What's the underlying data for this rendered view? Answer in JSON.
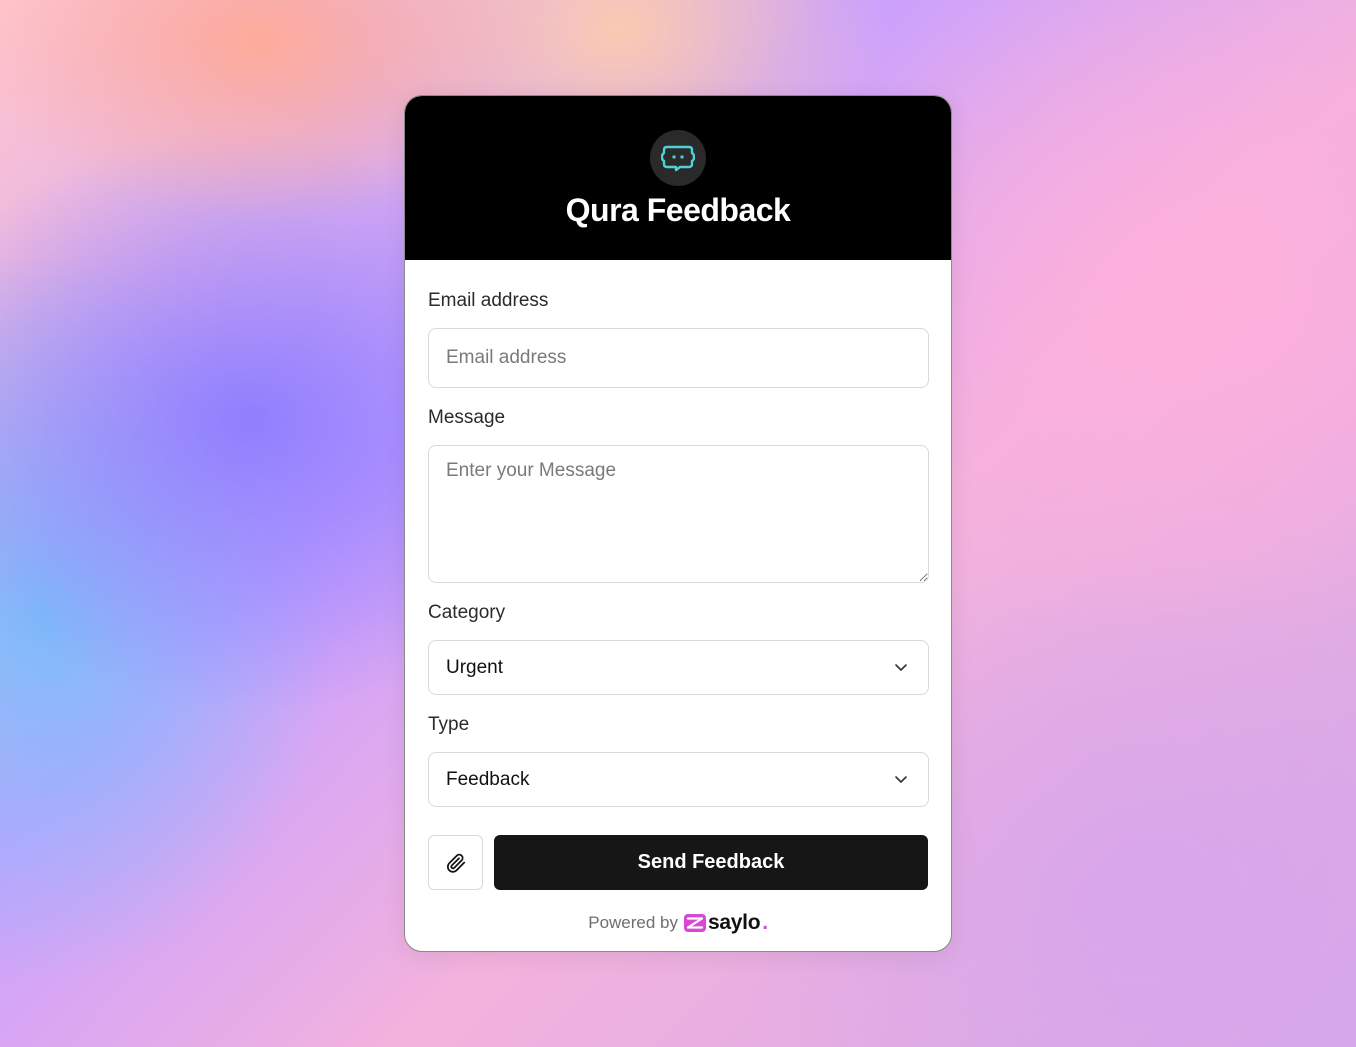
{
  "app": {
    "title": "Qura Feedback",
    "logo_icon": "chat-bubble-icon",
    "accent_color": "#4fd1d9"
  },
  "form": {
    "email": {
      "label": "Email address",
      "placeholder": "Email address",
      "value": ""
    },
    "message": {
      "label": "Message",
      "placeholder": "Enter your Message",
      "value": ""
    },
    "category": {
      "label": "Category",
      "selected": "Urgent"
    },
    "type": {
      "label": "Type",
      "selected": "Feedback"
    },
    "attach_icon": "paperclip-icon",
    "submit_label": "Send Feedback"
  },
  "footer": {
    "powered_by": "Powered by",
    "brand_name": "saylo",
    "brand_dot": ".",
    "brand_color": "#d848d4"
  }
}
